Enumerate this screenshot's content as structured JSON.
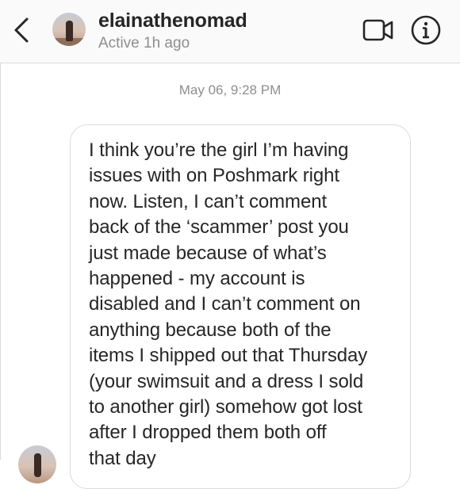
{
  "header": {
    "username": "elainathenomad",
    "status": "Active 1h ago",
    "back_icon": "chevron-left-icon",
    "video_icon": "video-camera-icon",
    "info_icon": "info-circle-icon"
  },
  "thread": {
    "timestamp": "May 06, 9:28 PM",
    "message_lines": [
      "I think you’re the girl I’m having",
      "issues with on Poshmark right",
      "now. Listen, I can’t comment",
      "back of the ‘scammer’ post you",
      "just made because of what’s",
      "happened - my account is",
      "disabled and I can’t comment on",
      "anything because both of the",
      "items I shipped out that Thursday",
      "(your swimsuit and a dress I sold",
      "to another girl) somehow got lost",
      "after I dropped them both off",
      "that day"
    ]
  },
  "colors": {
    "text_primary": "#262626",
    "text_secondary": "#8e8e8e",
    "border": "#dbdbdb",
    "header_bg": "#fafafa"
  }
}
